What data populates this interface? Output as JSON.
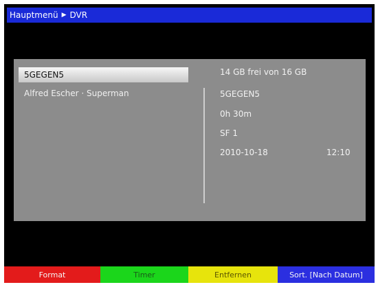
{
  "header": {
    "breadcrumb_root": "Hauptmenü",
    "breadcrumb_current": "DVR"
  },
  "recordings": {
    "selected": "5GEGEN5",
    "items": [
      "Alfred Escher · Superman"
    ]
  },
  "details": {
    "storage": "14 GB frei von 16 GB",
    "title": "5GEGEN5",
    "duration": "0h 30m",
    "channel": "SF 1",
    "date": "2010-10-18",
    "time": "12:10"
  },
  "colorbar": {
    "red_label": "Format",
    "green_label": "Timer",
    "yellow_label": "Entfernen",
    "blue_label": "Sort. [Nach Datum]"
  },
  "colors": {
    "title_bar": "#1a2ad8",
    "panel": "#8c8c8c",
    "red": "#e31b1b",
    "green": "#1bd61b",
    "yellow": "#e7e40c",
    "blue": "#2b2fe0"
  }
}
